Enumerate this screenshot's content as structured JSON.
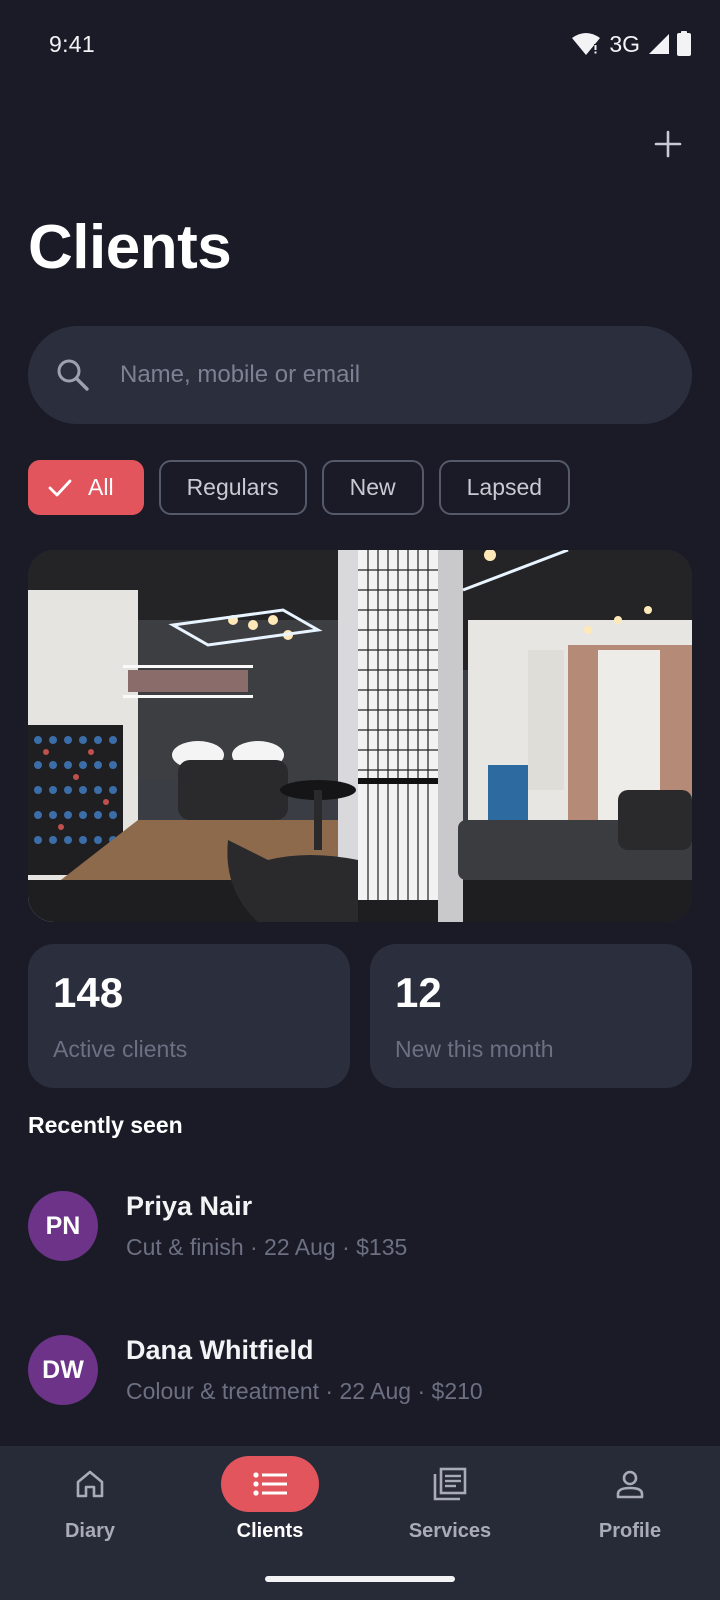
{
  "status_bar": {
    "time": "9:41",
    "network": "3G"
  },
  "header": {
    "title": "Clients"
  },
  "search": {
    "placeholder": "Name, mobile or email",
    "value": ""
  },
  "filters": [
    {
      "label": "All",
      "selected": true
    },
    {
      "label": "Regulars",
      "selected": false
    },
    {
      "label": "New",
      "selected": false
    },
    {
      "label": "Lapsed",
      "selected": false
    }
  ],
  "stats": [
    {
      "value": "148",
      "label": "Active clients"
    },
    {
      "value": "12",
      "label": "New this month"
    }
  ],
  "recently_seen": {
    "title": "Recently seen",
    "clients": [
      {
        "initials": "PN",
        "name": "Priya Nair",
        "detail": "Cut & finish · 22 Aug · $135"
      },
      {
        "initials": "DW",
        "name": "Dana Whitfield",
        "detail": "Colour & treatment · 22 Aug · $210"
      }
    ]
  },
  "bottom_nav": [
    {
      "label": "Diary",
      "icon": "home-icon",
      "active": false
    },
    {
      "label": "Clients",
      "icon": "list-icon",
      "active": true
    },
    {
      "label": "Services",
      "icon": "services-icon",
      "active": false
    },
    {
      "label": "Profile",
      "icon": "person-icon",
      "active": false
    }
  ],
  "colors": {
    "background": "#1a1b26",
    "surface": "#2b2e3c",
    "accent": "#e2555d",
    "avatar": "#6c3389"
  }
}
